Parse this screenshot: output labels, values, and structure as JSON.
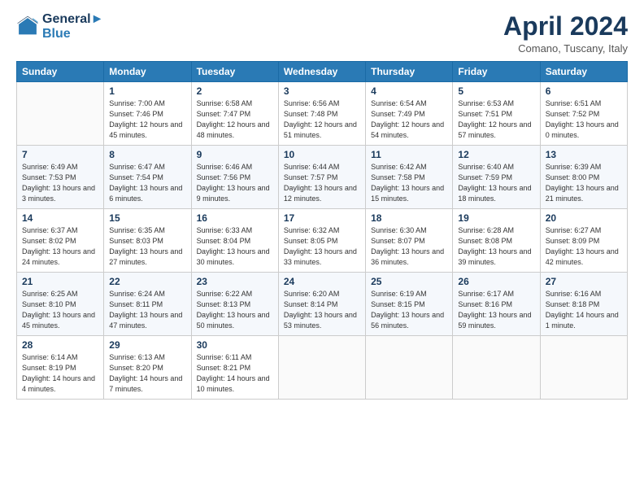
{
  "header": {
    "logo_line1": "General",
    "logo_line2": "Blue",
    "month": "April 2024",
    "location": "Comano, Tuscany, Italy"
  },
  "weekdays": [
    "Sunday",
    "Monday",
    "Tuesday",
    "Wednesday",
    "Thursday",
    "Friday",
    "Saturday"
  ],
  "weeks": [
    [
      {
        "day": "",
        "sunrise": "",
        "sunset": "",
        "daylight": ""
      },
      {
        "day": "1",
        "sunrise": "7:00 AM",
        "sunset": "7:46 PM",
        "daylight": "12 hours and 45 minutes."
      },
      {
        "day": "2",
        "sunrise": "6:58 AM",
        "sunset": "7:47 PM",
        "daylight": "12 hours and 48 minutes."
      },
      {
        "day": "3",
        "sunrise": "6:56 AM",
        "sunset": "7:48 PM",
        "daylight": "12 hours and 51 minutes."
      },
      {
        "day": "4",
        "sunrise": "6:54 AM",
        "sunset": "7:49 PM",
        "daylight": "12 hours and 54 minutes."
      },
      {
        "day": "5",
        "sunrise": "6:53 AM",
        "sunset": "7:51 PM",
        "daylight": "12 hours and 57 minutes."
      },
      {
        "day": "6",
        "sunrise": "6:51 AM",
        "sunset": "7:52 PM",
        "daylight": "13 hours and 0 minutes."
      }
    ],
    [
      {
        "day": "7",
        "sunrise": "6:49 AM",
        "sunset": "7:53 PM",
        "daylight": "13 hours and 3 minutes."
      },
      {
        "day": "8",
        "sunrise": "6:47 AM",
        "sunset": "7:54 PM",
        "daylight": "13 hours and 6 minutes."
      },
      {
        "day": "9",
        "sunrise": "6:46 AM",
        "sunset": "7:56 PM",
        "daylight": "13 hours and 9 minutes."
      },
      {
        "day": "10",
        "sunrise": "6:44 AM",
        "sunset": "7:57 PM",
        "daylight": "13 hours and 12 minutes."
      },
      {
        "day": "11",
        "sunrise": "6:42 AM",
        "sunset": "7:58 PM",
        "daylight": "13 hours and 15 minutes."
      },
      {
        "day": "12",
        "sunrise": "6:40 AM",
        "sunset": "7:59 PM",
        "daylight": "13 hours and 18 minutes."
      },
      {
        "day": "13",
        "sunrise": "6:39 AM",
        "sunset": "8:00 PM",
        "daylight": "13 hours and 21 minutes."
      }
    ],
    [
      {
        "day": "14",
        "sunrise": "6:37 AM",
        "sunset": "8:02 PM",
        "daylight": "13 hours and 24 minutes."
      },
      {
        "day": "15",
        "sunrise": "6:35 AM",
        "sunset": "8:03 PM",
        "daylight": "13 hours and 27 minutes."
      },
      {
        "day": "16",
        "sunrise": "6:33 AM",
        "sunset": "8:04 PM",
        "daylight": "13 hours and 30 minutes."
      },
      {
        "day": "17",
        "sunrise": "6:32 AM",
        "sunset": "8:05 PM",
        "daylight": "13 hours and 33 minutes."
      },
      {
        "day": "18",
        "sunrise": "6:30 AM",
        "sunset": "8:07 PM",
        "daylight": "13 hours and 36 minutes."
      },
      {
        "day": "19",
        "sunrise": "6:28 AM",
        "sunset": "8:08 PM",
        "daylight": "13 hours and 39 minutes."
      },
      {
        "day": "20",
        "sunrise": "6:27 AM",
        "sunset": "8:09 PM",
        "daylight": "13 hours and 42 minutes."
      }
    ],
    [
      {
        "day": "21",
        "sunrise": "6:25 AM",
        "sunset": "8:10 PM",
        "daylight": "13 hours and 45 minutes."
      },
      {
        "day": "22",
        "sunrise": "6:24 AM",
        "sunset": "8:11 PM",
        "daylight": "13 hours and 47 minutes."
      },
      {
        "day": "23",
        "sunrise": "6:22 AM",
        "sunset": "8:13 PM",
        "daylight": "13 hours and 50 minutes."
      },
      {
        "day": "24",
        "sunrise": "6:20 AM",
        "sunset": "8:14 PM",
        "daylight": "13 hours and 53 minutes."
      },
      {
        "day": "25",
        "sunrise": "6:19 AM",
        "sunset": "8:15 PM",
        "daylight": "13 hours and 56 minutes."
      },
      {
        "day": "26",
        "sunrise": "6:17 AM",
        "sunset": "8:16 PM",
        "daylight": "13 hours and 59 minutes."
      },
      {
        "day": "27",
        "sunrise": "6:16 AM",
        "sunset": "8:18 PM",
        "daylight": "14 hours and 1 minute."
      }
    ],
    [
      {
        "day": "28",
        "sunrise": "6:14 AM",
        "sunset": "8:19 PM",
        "daylight": "14 hours and 4 minutes."
      },
      {
        "day": "29",
        "sunrise": "6:13 AM",
        "sunset": "8:20 PM",
        "daylight": "14 hours and 7 minutes."
      },
      {
        "day": "30",
        "sunrise": "6:11 AM",
        "sunset": "8:21 PM",
        "daylight": "14 hours and 10 minutes."
      },
      {
        "day": "",
        "sunrise": "",
        "sunset": "",
        "daylight": ""
      },
      {
        "day": "",
        "sunrise": "",
        "sunset": "",
        "daylight": ""
      },
      {
        "day": "",
        "sunrise": "",
        "sunset": "",
        "daylight": ""
      },
      {
        "day": "",
        "sunrise": "",
        "sunset": "",
        "daylight": ""
      }
    ]
  ]
}
